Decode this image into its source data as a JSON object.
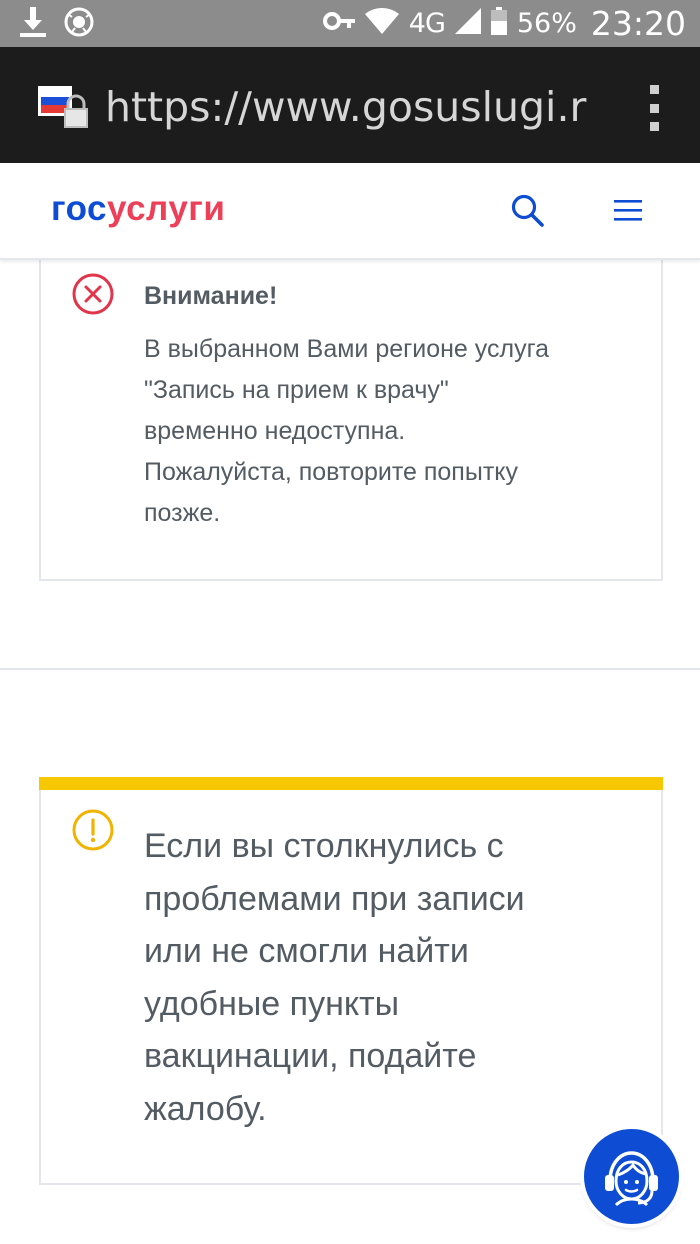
{
  "status_bar": {
    "network": "4G",
    "battery_percent": "56%",
    "time": "23:20",
    "icons": [
      "download-icon",
      "app-icon",
      "key-icon",
      "wifi-icon",
      "signal-icon",
      "battery-icon"
    ],
    "battery_level": 0.56
  },
  "browser": {
    "url": "https://www.gosuslugi.r",
    "icons": [
      "site-icon",
      "lock-icon",
      "overflow-menu-icon"
    ]
  },
  "header": {
    "logo_part1": "гос",
    "logo_part2": "услуги",
    "brand_blue": "#0d4cd3",
    "brand_red": "#ee3f58",
    "icons": [
      "search-icon",
      "menu-icon"
    ]
  },
  "alert": {
    "title": "Внимание!",
    "lines": [
      "В выбранном Вами регионе услуга",
      "\"Запись на прием к врачу\"",
      "временно недоступна.",
      "Пожалуйста, повторите попытку",
      "позже."
    ],
    "icon": "error-icon",
    "color": "#e2354a"
  },
  "warning": {
    "lines": [
      "Если вы столкнулись с",
      "проблемами при записи",
      "или не смогли найти",
      "удобные пункты",
      "вакцинации, подайте",
      "жалобу."
    ],
    "icon": "warning-icon",
    "accent": "#f7c800"
  },
  "support": {
    "icon": "support-agent-icon"
  }
}
